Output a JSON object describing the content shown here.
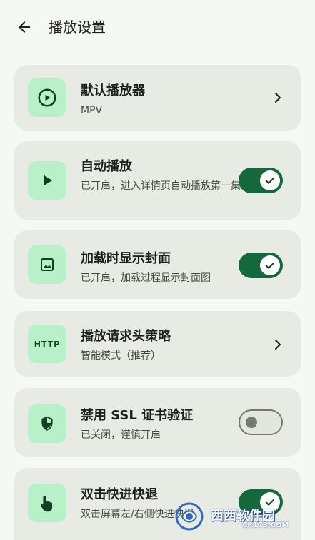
{
  "header": {
    "title": "播放设置"
  },
  "colors": {
    "background": "#f6f8f3",
    "card": "#e8ebe4",
    "icon_bg": "#b8f0c7",
    "accent": "#13693c",
    "text_primary": "#1d201c",
    "text_secondary": "#42493f"
  },
  "settings": [
    {
      "title": "默认播放器",
      "subtitle": "MPV",
      "icon": "play-circle-icon",
      "control": "chevron"
    },
    {
      "title": "自动播放",
      "subtitle": "已开启，进入详情页自动播放第一集",
      "icon": "play-icon",
      "control": "toggle",
      "enabled": true
    },
    {
      "title": "加载时显示封面",
      "subtitle": "已开启，加载过程显示封面图",
      "icon": "image-icon",
      "control": "toggle",
      "enabled": true
    },
    {
      "title": "播放请求头策略",
      "subtitle": "智能模式（推荐）",
      "icon": "http-icon",
      "icon_text": "HTTP",
      "control": "chevron"
    },
    {
      "title": "禁用 SSL 证书验证",
      "subtitle": "已关闭，谨慎开启",
      "icon": "shield-icon",
      "control": "toggle",
      "enabled": false
    },
    {
      "title": "双击快进快退",
      "subtitle": "双击屏幕左/右侧快进快退",
      "icon": "touch-icon",
      "control": "toggle",
      "enabled": true
    }
  ],
  "watermark": {
    "brand": "西西软件园",
    "domain": "CR173.COM"
  }
}
